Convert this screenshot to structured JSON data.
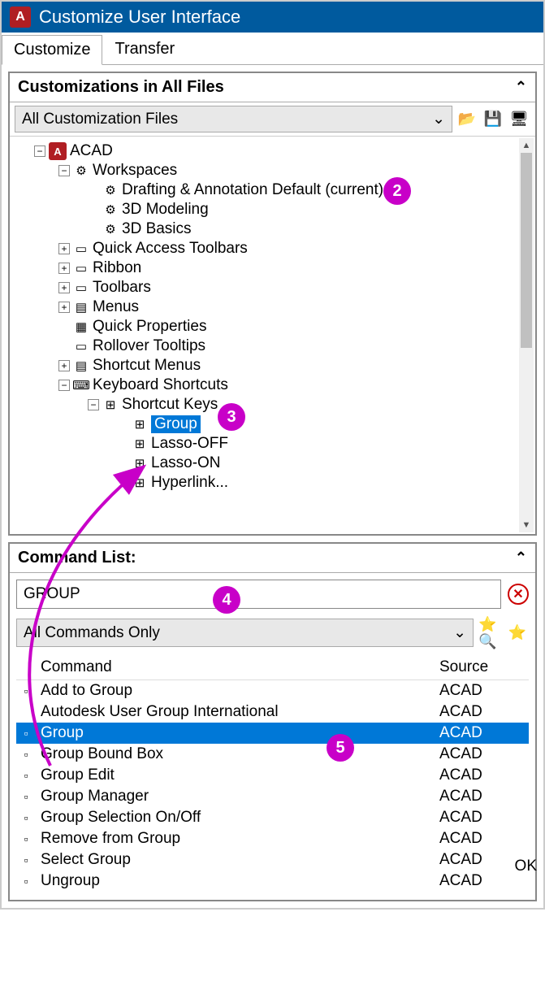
{
  "window": {
    "title": "Customize User Interface",
    "app_icon_letter": "A"
  },
  "tabs": {
    "customize": "Customize",
    "transfer": "Transfer"
  },
  "panel1": {
    "title": "Customizations in All Files",
    "dropdown": "All Customization Files"
  },
  "tree": {
    "root": "ACAD",
    "workspaces": "Workspaces",
    "ws_items": [
      "Drafting & Annotation Default (current)",
      "3D Modeling",
      "3D Basics"
    ],
    "qat": "Quick Access Toolbars",
    "ribbon": "Ribbon",
    "toolbars": "Toolbars",
    "menus": "Menus",
    "quickprops": "Quick Properties",
    "rollover": "Rollover Tooltips",
    "shortcut_menus": "Shortcut Menus",
    "keyboard": "Keyboard Shortcuts",
    "shortcut_keys": "Shortcut Keys",
    "sk_items": [
      "Group",
      "Lasso-OFF",
      "Lasso-ON",
      "Hyperlink..."
    ]
  },
  "panel2": {
    "title": "Command List:"
  },
  "search": {
    "value": "GROUP"
  },
  "filter": {
    "value": "All Commands Only"
  },
  "cmd_header": {
    "col1": "Command",
    "col2": "Source"
  },
  "commands": [
    {
      "name": "Add to Group",
      "source": "ACAD"
    },
    {
      "name": "Autodesk User Group International",
      "source": "ACAD"
    },
    {
      "name": "Group",
      "source": "ACAD"
    },
    {
      "name": "Group Bound Box",
      "source": "ACAD"
    },
    {
      "name": "Group Edit",
      "source": "ACAD"
    },
    {
      "name": "Group Manager",
      "source": "ACAD"
    },
    {
      "name": "Group Selection On/Off",
      "source": "ACAD"
    },
    {
      "name": "Remove from Group",
      "source": "ACAD"
    },
    {
      "name": "Select Group",
      "source": "ACAD"
    },
    {
      "name": "Ungroup",
      "source": "ACAD"
    }
  ],
  "callouts": {
    "c2": "2",
    "c3": "3",
    "c4": "4",
    "c5": "5"
  },
  "ok": "OK"
}
